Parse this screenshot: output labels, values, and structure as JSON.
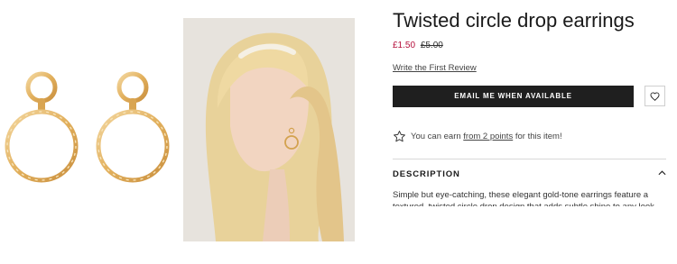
{
  "gallery": {
    "product_image_alt": "Twisted circle drop earrings",
    "model_image_alt": "Model wearing twisted circle drop earrings"
  },
  "product": {
    "title": "Twisted circle drop earrings",
    "price_now": "£1.50",
    "price_was": "£5.00",
    "review_link": "Write the First Review"
  },
  "actions": {
    "notify_label": "EMAIL ME WHEN AVAILABLE",
    "wishlist_icon": "heart-icon"
  },
  "points": {
    "icon": "star-icon",
    "prefix": "You can earn ",
    "link": "from 2 points",
    "suffix": " for this item!"
  },
  "description": {
    "title": "DESCRIPTION",
    "toggle_icon": "chevron-up-icon",
    "text": "Simple but eye-catching, these elegant gold-tone earrings feature a textured, twisted circle drop design that adds subtle shine to any look."
  },
  "colors": {
    "sale_price": "#b5103c",
    "button_background": "#1f1f1f",
    "gold": "#e2b05d"
  }
}
